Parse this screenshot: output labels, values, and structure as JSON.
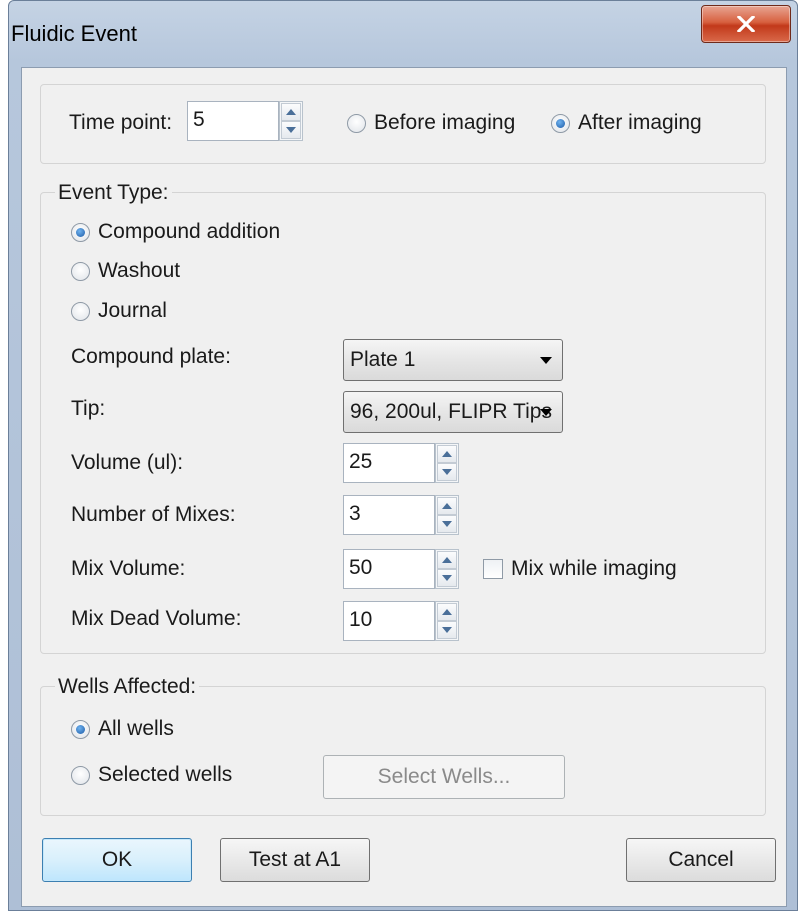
{
  "window": {
    "title": "Fluidic Event"
  },
  "timepoint": {
    "label": "Time point:",
    "value": "5",
    "before_label": "Before imaging",
    "after_label": "After imaging",
    "selected": "after"
  },
  "event_type": {
    "legend": "Event Type:",
    "options": [
      "Compound addition",
      "Washout",
      "Journal"
    ],
    "selected": "Compound addition",
    "compound_plate": {
      "label": "Compound plate:",
      "value": "Plate 1"
    },
    "tip": {
      "label": "Tip:",
      "value": "96, 200ul, FLIPR Tips"
    },
    "volume": {
      "label": "Volume (ul):",
      "value": "25"
    },
    "mixes": {
      "label": "Number of Mixes:",
      "value": "3"
    },
    "mix_volume": {
      "label": "Mix Volume:",
      "value": "50"
    },
    "mix_while_imaging": {
      "label": "Mix while imaging",
      "checked": false
    },
    "dead_volume": {
      "label": "Mix Dead Volume:",
      "value": "10"
    }
  },
  "wells": {
    "legend": "Wells Affected:",
    "all_label": "All wells",
    "selected_label": "Selected wells",
    "selected": "all",
    "select_button": "Select Wells..."
  },
  "buttons": {
    "ok": "OK",
    "test": "Test at A1",
    "cancel": "Cancel"
  },
  "icons": {
    "close": "close-icon",
    "spin_up": "spin-up-icon",
    "spin_down": "spin-down-icon",
    "dropdown": "chevron-down-icon"
  },
  "colors": {
    "titlebar": "#b6c7dc",
    "close_button": "#c9432a",
    "dialog_background": "#f0f0f0",
    "default_button_border": "#3c7fb1"
  }
}
